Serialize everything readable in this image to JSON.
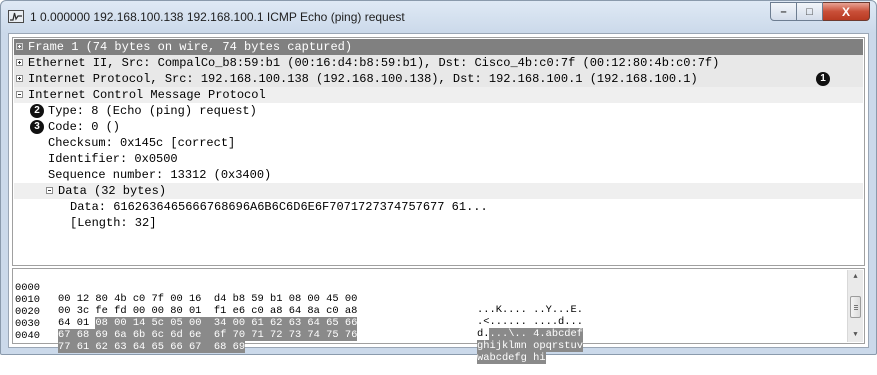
{
  "window": {
    "title": "1 0.000000 192.168.100.138 192.168.100.1 ICMP Echo (ping) request",
    "buttons": {
      "minimize": "–",
      "maximize": "□",
      "close": "X"
    }
  },
  "tree": {
    "frame": "Frame 1 (74 bytes on wire, 74 bytes captured)",
    "ethernet": "Ethernet II, Src: CompalCo_b8:59:b1 (00:16:d4:b8:59:b1), Dst: Cisco_4b:c0:7f (00:12:80:4b:c0:7f)",
    "ip": "Internet Protocol, Src: 192.168.100.138 (192.168.100.138), Dst: 192.168.100.1 (192.168.100.1)",
    "icmp": "Internet Control Message Protocol",
    "type": "Type: 8 (Echo (ping) request)",
    "code": "Code: 0 ()",
    "checksum": "Checksum: 0x145c [correct]",
    "identifier": "Identifier: 0x0500",
    "sequence": "Sequence number: 13312 (0x3400)",
    "data": "Data (32 bytes)",
    "data_value": "Data: 6162636465666768696A6B6C6D6E6F7071727374757677 61...",
    "length": "[Length: 32]",
    "markers": {
      "ip": "1",
      "type": "2",
      "code": "3"
    }
  },
  "hex": {
    "rows": [
      {
        "offset": "0000",
        "bytes_plain": "00 12 80 4b c0 7f 00 16  d4 b8 59 b1 08 00 45 00",
        "bytes_hl": "",
        "ascii_plain": "...K.... ..Y...E.",
        "ascii_hl": ""
      },
      {
        "offset": "0010",
        "bytes_plain": "00 3c fe fd 00 00 80 01  f1 e6 c0 a8 64 8a c0 a8",
        "bytes_hl": "",
        "ascii_plain": ".<...... ....d...",
        "ascii_hl": ""
      },
      {
        "offset": "0020",
        "bytes_plain": "64 01 ",
        "bytes_hl": "08 00 14 5c 05 00  34 00 61 62 63 64 65 66",
        "ascii_plain": "d.",
        "ascii_hl": "...\\.. 4.abcdef"
      },
      {
        "offset": "0030",
        "bytes_plain": "",
        "bytes_hl": "67 68 69 6a 6b 6c 6d 6e  6f 70 71 72 73 74 75 76",
        "ascii_plain": "",
        "ascii_hl": "ghijklmn opqrstuv"
      },
      {
        "offset": "0040",
        "bytes_plain": "",
        "bytes_hl": "77 61 62 63 64 65 66 67  68 69",
        "ascii_plain": "",
        "ascii_hl": "wabcdefg hi"
      }
    ]
  }
}
